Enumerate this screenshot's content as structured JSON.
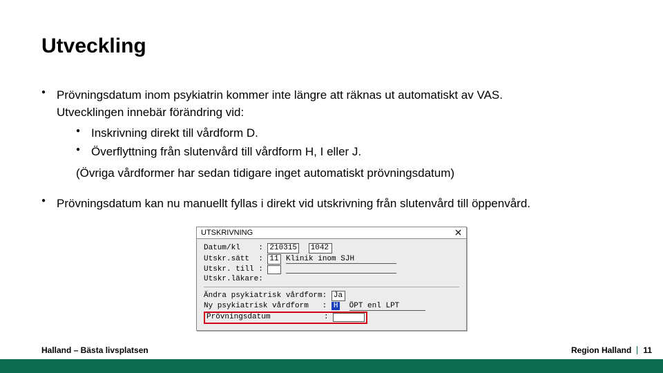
{
  "title": "Utveckling",
  "bullets": {
    "b1_line1": "Prövningsdatum inom psykiatrin kommer inte längre att räknas ut automatiskt av VAS.",
    "b1_line2": "Utvecklingen innebär förändring vid:",
    "b1_sub1": "Inskrivning direkt till vårdform D.",
    "b1_sub2": "Överflyttning från slutenvård till vårdform H, I eller J.",
    "b1_paren": "(Övriga vårdformer har sedan tidigare inget automatiskt prövningsdatum)",
    "b2": "Prövningsdatum kan nu manuellt fyllas i direkt vid utskrivning från slutenvård till öppenvård."
  },
  "dialog": {
    "title": "UTSKRIVNING",
    "labels": {
      "datum": "Datum/kl    : ",
      "satt": "Utskr.sätt  : ",
      "till": "Utskr. till : ",
      "lakare": "Utskr.läkare:",
      "andra": "Ändra psykiatrisk vårdform: ",
      "nyform": "Ny psykiatrisk vårdform   : ",
      "provn": "Prövningsdatum",
      "provn_colon": ":"
    },
    "values": {
      "datum_date": "210315",
      "datum_time": "1042",
      "satt_code": "11",
      "satt_text": "Klinik inom SJH",
      "andra": "Ja",
      "nyform_code": "H",
      "nyform_text": "ÖPT enl LPT"
    }
  },
  "footer": {
    "left": "Halland – Bästa livsplatsen",
    "right": "Region Halland",
    "page": "11"
  }
}
